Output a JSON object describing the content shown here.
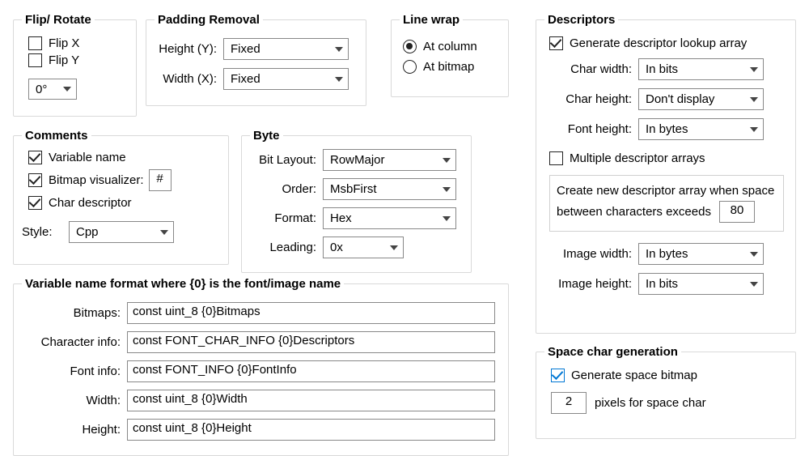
{
  "fliprotate": {
    "legend": "Flip/ Rotate",
    "flipx": "Flip X",
    "flipy": "Flip Y",
    "angle": "0°"
  },
  "padding": {
    "legend": "Padding Removal",
    "height_label": "Height (Y):",
    "height_value": "Fixed",
    "width_label": "Width (X):",
    "width_value": "Fixed"
  },
  "linewrap": {
    "legend": "Line wrap",
    "at_column": "At column",
    "at_bitmap": "At bitmap"
  },
  "comments": {
    "legend": "Comments",
    "variable_name": "Variable name",
    "bitmap_visualizer": "Bitmap visualizer:",
    "bitmap_char": "#",
    "char_descriptor": "Char descriptor",
    "style_label": "Style:",
    "style_value": "Cpp"
  },
  "byte": {
    "legend": "Byte",
    "bit_layout_label": "Bit Layout:",
    "bit_layout_value": "RowMajor",
    "order_label": "Order:",
    "order_value": "MsbFirst",
    "format_label": "Format:",
    "format_value": "Hex",
    "leading_label": "Leading:",
    "leading_value": "0x"
  },
  "descriptors": {
    "legend": "Descriptors",
    "gen_lookup": "Generate descriptor lookup array",
    "char_width_label": "Char width:",
    "char_width_value": "In bits",
    "char_height_label": "Char height:",
    "char_height_value": "Don't display",
    "font_height_label": "Font height:",
    "font_height_value": "In bytes",
    "multiple_arrays": "Multiple descriptor arrays",
    "create_new_text1": "Create new descriptor array when space",
    "create_new_text2": "between characters exceeds",
    "create_new_value": "80",
    "image_width_label": "Image width:",
    "image_width_value": "In bytes",
    "image_height_label": "Image height:",
    "image_height_value": "In bits"
  },
  "space": {
    "legend": "Space char generation",
    "generate": "Generate space bitmap",
    "pixels_value": "2",
    "pixels_label": "pixels for space char"
  },
  "varfmt": {
    "legend": "Variable name format where {0} is the font/image name",
    "bitmaps_label": "Bitmaps:",
    "bitmaps_value": "const uint_8 {0}Bitmaps",
    "charinfo_label": "Character info:",
    "charinfo_value": "const FONT_CHAR_INFO {0}Descriptors",
    "fontinfo_label": "Font info:",
    "fontinfo_value": "const FONT_INFO {0}FontInfo",
    "width_label": "Width:",
    "width_value": "const uint_8 {0}Width",
    "height_label": "Height:",
    "height_value": "const uint_8 {0}Height"
  }
}
